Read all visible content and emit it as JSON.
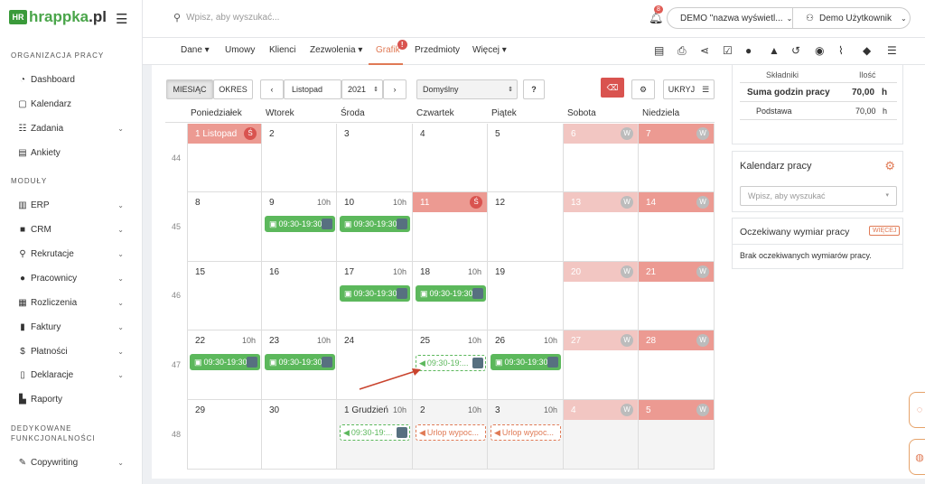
{
  "sidebar": {
    "logo_box": "HR",
    "logo_text": "hrappka",
    "logo_tld": ".pl",
    "section_org": "ORGANIZACJA PRACY",
    "org_items": [
      {
        "label": "Dashboard",
        "icon": "dashboard-icon"
      },
      {
        "label": "Kalendarz",
        "icon": "calendar-icon"
      },
      {
        "label": "Zadania",
        "icon": "tasks-icon"
      },
      {
        "label": "Ankiety",
        "icon": "survey-icon"
      }
    ],
    "section_modules": "MODUŁY",
    "module_items": [
      {
        "label": "ERP",
        "icon": "building-icon"
      },
      {
        "label": "CRM",
        "icon": "truck-icon"
      },
      {
        "label": "Rekrutacje",
        "icon": "search-icon"
      },
      {
        "label": "Pracownicy",
        "icon": "users-icon"
      },
      {
        "label": "Rozliczenia",
        "icon": "calculator-icon"
      },
      {
        "label": "Faktury",
        "icon": "invoice-icon"
      },
      {
        "label": "Płatności",
        "icon": "dollar-icon"
      },
      {
        "label": "Deklaracje",
        "icon": "file-icon"
      },
      {
        "label": "Raporty",
        "icon": "chart-icon"
      }
    ],
    "section_dedicated_1": "DEDYKOWANE",
    "section_dedicated_2": "FUNKCJONALNOŚCI",
    "dedicated_items": [
      {
        "label": "Copywriting",
        "icon": "brush-icon"
      }
    ]
  },
  "topbar": {
    "search_placeholder": "Wpisz, aby wyszukać...",
    "notifications_count": "8",
    "company_select": "DEMO \"nazwa wyświetl...",
    "user_select": "Demo Użytkownik"
  },
  "tabs": [
    {
      "label": "Dane ▾"
    },
    {
      "label": "Umowy"
    },
    {
      "label": "Klienci"
    },
    {
      "label": "Zezwolenia ▾"
    },
    {
      "label": "Grafik"
    },
    {
      "label": "Przedmioty"
    },
    {
      "label": "Więcej ▾"
    }
  ],
  "toolbar": {
    "view_month": "MIESIĄC",
    "view_range": "OKRES",
    "month": "Listopad",
    "year": "2021",
    "template": "Domyślny",
    "help": "?",
    "hide": "UKRYJ"
  },
  "calendar": {
    "weekdays": [
      "Poniedziałek",
      "Wtorek",
      "Środa",
      "Czwartek",
      "Piątek",
      "Sobota",
      "Niedziela"
    ],
    "weeks": [
      "44",
      "45",
      "46",
      "47",
      "48"
    ],
    "days": [
      [
        "1 Listopad",
        "2",
        "3",
        "4",
        "5",
        "6",
        "7"
      ],
      [
        "8",
        "9",
        "10",
        "11",
        "12",
        "13",
        "14"
      ],
      [
        "15",
        "16",
        "17",
        "18",
        "19",
        "20",
        "21"
      ],
      [
        "22",
        "23",
        "24",
        "25",
        "26",
        "27",
        "28"
      ],
      [
        "29",
        "30",
        "1 Grudzień",
        "2",
        "3",
        "4",
        "5"
      ]
    ],
    "hours_label": "10h",
    "weekend_marker": "W",
    "holiday_marker": "Ś",
    "shift_text": "09:30-19:30",
    "shift_dashed_text": "09:30-19:...",
    "leave_text": "Urlop wypoc..."
  },
  "summary": {
    "col_items": "Składniki",
    "col_qty": "Ilość",
    "total_label": "Suma godzin pracy",
    "total_value": "70,00",
    "total_unit": "h",
    "base_label": "Podstawa",
    "base_value": "70,00",
    "base_unit": "h"
  },
  "work_calendar": {
    "title": "Kalendarz pracy",
    "placeholder": "Wpisz, aby wyszukać"
  },
  "expected": {
    "title": "Oczekiwany wymiar pracy",
    "more": "WIĘCEJ",
    "message": "Brak oczekiwanych wymiarów pracy."
  },
  "colors": {
    "brand_green": "#4aa54a",
    "shift_green": "#5cb85c",
    "accent_orange": "#e07a55",
    "holiday_red": "#d9534f"
  }
}
